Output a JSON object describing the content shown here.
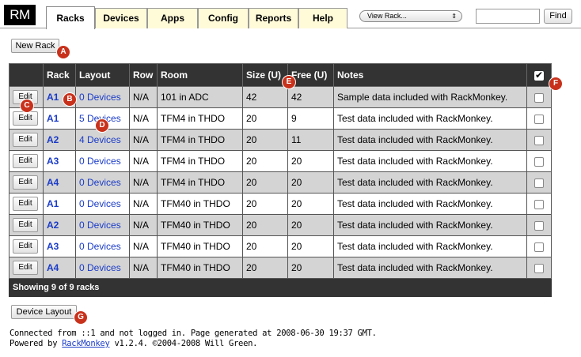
{
  "app": {
    "logo": "RM"
  },
  "tabs": [
    {
      "label": "Racks",
      "active": true
    },
    {
      "label": "Devices",
      "active": false
    },
    {
      "label": "Apps",
      "active": false
    },
    {
      "label": "Config",
      "active": false
    },
    {
      "label": "Reports",
      "active": false
    },
    {
      "label": "Help",
      "active": false
    }
  ],
  "view_select": {
    "selected": "View Rack...",
    "arrows": "⇕"
  },
  "search": {
    "value": "",
    "find_label": "Find"
  },
  "new_rack_label": "New Rack",
  "table": {
    "headers": [
      "",
      "Rack",
      "Layout",
      "Row",
      "Room",
      "Size (U)",
      "Free (U)",
      "Notes",
      ""
    ],
    "edit_label": "Edit",
    "rows": [
      {
        "rack": "A1",
        "layout": "0 Devices",
        "row": "N/A",
        "room": "101 in ADC",
        "size": "42",
        "free": "42",
        "notes": "Sample data included with RackMonkey."
      },
      {
        "rack": "A1",
        "layout": "5 Devices",
        "row": "N/A",
        "room": "TFM4 in THDO",
        "size": "20",
        "free": "9",
        "notes": "Test data included with RackMonkey."
      },
      {
        "rack": "A2",
        "layout": "4 Devices",
        "row": "N/A",
        "room": "TFM4 in THDO",
        "size": "20",
        "free": "11",
        "notes": "Test data included with RackMonkey."
      },
      {
        "rack": "A3",
        "layout": "0 Devices",
        "row": "N/A",
        "room": "TFM4 in THDO",
        "size": "20",
        "free": "20",
        "notes": "Test data included with RackMonkey."
      },
      {
        "rack": "A4",
        "layout": "0 Devices",
        "row": "N/A",
        "room": "TFM4 in THDO",
        "size": "20",
        "free": "20",
        "notes": "Test data included with RackMonkey."
      },
      {
        "rack": "A1",
        "layout": "0 Devices",
        "row": "N/A",
        "room": "TFM40 in THDO",
        "size": "20",
        "free": "20",
        "notes": "Test data included with RackMonkey."
      },
      {
        "rack": "A2",
        "layout": "0 Devices",
        "row": "N/A",
        "room": "TFM40 in THDO",
        "size": "20",
        "free": "20",
        "notes": "Test data included with RackMonkey."
      },
      {
        "rack": "A3",
        "layout": "0 Devices",
        "row": "N/A",
        "room": "TFM40 in THDO",
        "size": "20",
        "free": "20",
        "notes": "Test data included with RackMonkey."
      },
      {
        "rack": "A4",
        "layout": "0 Devices",
        "row": "N/A",
        "room": "TFM40 in THDO",
        "size": "20",
        "free": "20",
        "notes": "Test data included with RackMonkey."
      }
    ],
    "footer": "Showing 9 of 9 racks"
  },
  "device_layout_label": "Device Layout",
  "status": {
    "line1": "Connected from ::1 and not logged in. Page generated at 2008-06-30 19:37 GMT.",
    "powered_prefix": "Powered by ",
    "powered_link": "RackMonkey",
    "powered_suffix": " v1.2.4. ©2004-2008 Will Green."
  },
  "badges": [
    "A",
    "B",
    "C",
    "D",
    "E",
    "F",
    "G"
  ],
  "colors": {
    "badge": "#c8311b",
    "link": "#1a3bc7",
    "header_bg": "#333333",
    "odd_row": "#d4d4d4",
    "tab_bg": "#fffbd9"
  }
}
